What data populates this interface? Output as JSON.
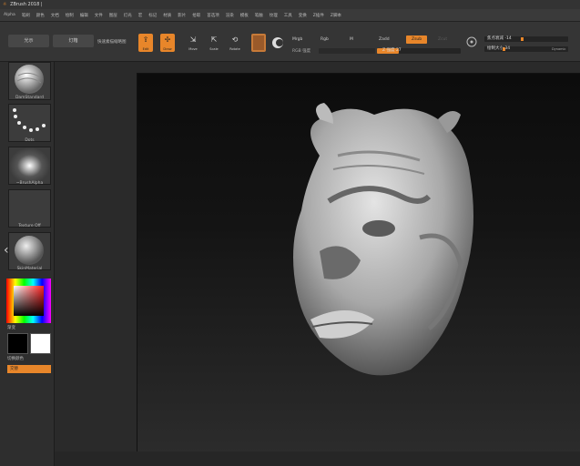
{
  "window": {
    "title": "ZBrush 2018 |"
  },
  "menu": [
    "Alpha",
    "笔刷",
    "颜色",
    "文档",
    "绘制",
    "编辑",
    "文件",
    "图层",
    "灯光",
    "宏",
    "标记",
    "材质",
    "影片",
    "拾取",
    "首选项",
    "渲染",
    "模板",
    "笔触",
    "纹理",
    "工具",
    "变换",
    "Z插件",
    "Z脚本"
  ],
  "toolbar": {
    "projection_btn": "光示",
    "lightbox_btn": "灯箱",
    "quicksketch": "快速素描缩略图",
    "tools": [
      {
        "name": "edit",
        "glyph": "⇪",
        "cap": "Edit",
        "active": true
      },
      {
        "name": "draw",
        "glyph": "✢",
        "cap": "Draw",
        "active": true
      },
      {
        "name": "move",
        "glyph": "⇲",
        "cap": "Move",
        "active": false
      },
      {
        "name": "scale",
        "glyph": "⇱",
        "cap": "Scale",
        "active": false
      },
      {
        "name": "rotate",
        "glyph": "⟲",
        "cap": "Rotate",
        "active": false
      }
    ],
    "mrgb": "Mrgb",
    "rgb": "Rgb",
    "m": "M",
    "rgb_intensity": "RGB 强度",
    "zadd": "Zadd",
    "zsub": "Zsub",
    "zcut": "Zcut",
    "z_intensity_label": "Z 强度 27",
    "focal_shift": "焦点衰减 -14",
    "draw_size": "绘制大小 34",
    "dynamic": "Dynamic"
  },
  "tray": {
    "brush": "DamStandard",
    "stroke": "Dots",
    "alpha": "~BrushAlpha",
    "texture": "Texture Off",
    "material": "SkinMaterial",
    "color_label": "渐变",
    "swatch_label": "切换颜色",
    "alternate_label": "交替"
  },
  "colors": {
    "accent": "#e8862a",
    "panel": "#353535",
    "bg": "#2b2b2b"
  },
  "icons": {
    "left_arrow": "‹"
  }
}
